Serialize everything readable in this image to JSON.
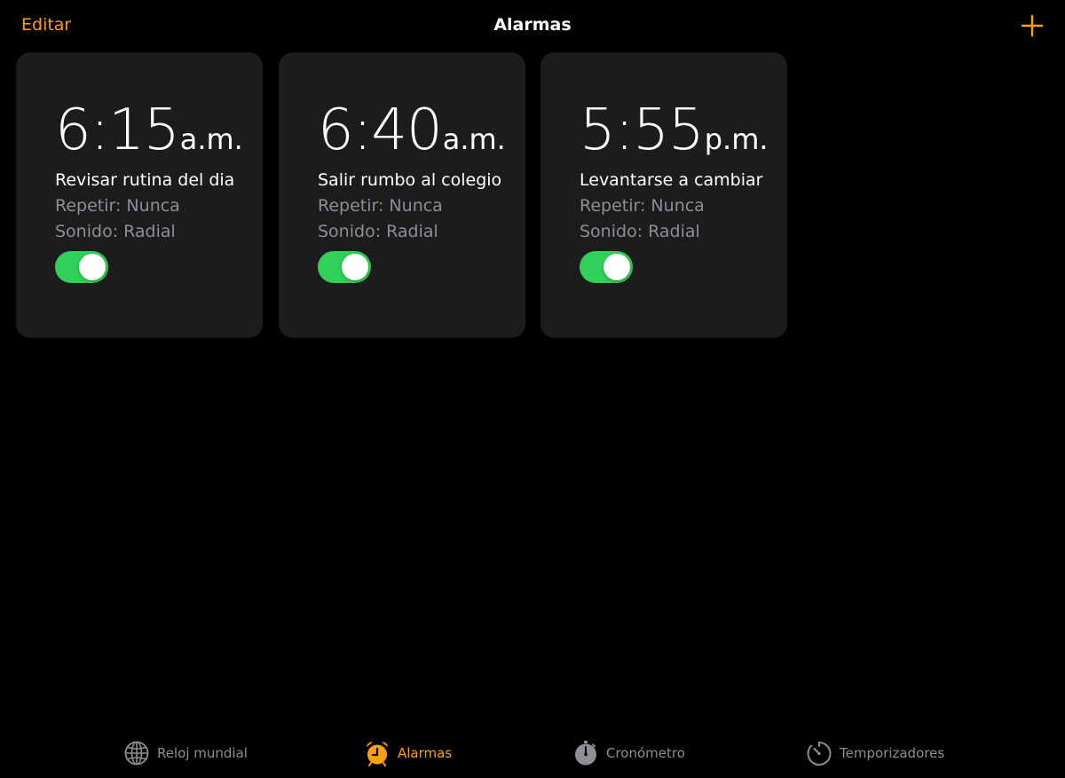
{
  "header": {
    "edit_label": "Editar",
    "title": "Alarmas",
    "add_icon": "plus-icon"
  },
  "colors": {
    "accent": "#ff9f0a",
    "toggle_on": "#30d158",
    "card_bg": "#1c1c1e",
    "secondary_text": "#8e8e93",
    "background": "#000000"
  },
  "alarms": [
    {
      "time": "6:15",
      "period": "a.m.",
      "label": "Revisar rutina del dia",
      "repeat": "Repetir: Nunca",
      "sound": "Sonido: Radial",
      "enabled": true
    },
    {
      "time": "6:40",
      "period": "a.m.",
      "label": "Salir rumbo al colegio",
      "repeat": "Repetir: Nunca",
      "sound": "Sonido: Radial",
      "enabled": true
    },
    {
      "time": "5:55",
      "period": "p.m.",
      "label": "Levantarse a cambiar",
      "repeat": "Repetir: Nunca",
      "sound": "Sonido: Radial",
      "enabled": true
    }
  ],
  "tabs": [
    {
      "label": "Reloj mundial",
      "icon": "globe-icon",
      "active": false
    },
    {
      "label": "Alarmas",
      "icon": "alarm-clock-icon",
      "active": true
    },
    {
      "label": "Cronómetro",
      "icon": "stopwatch-icon",
      "active": false
    },
    {
      "label": "Temporizadores",
      "icon": "timer-icon",
      "active": false
    }
  ]
}
